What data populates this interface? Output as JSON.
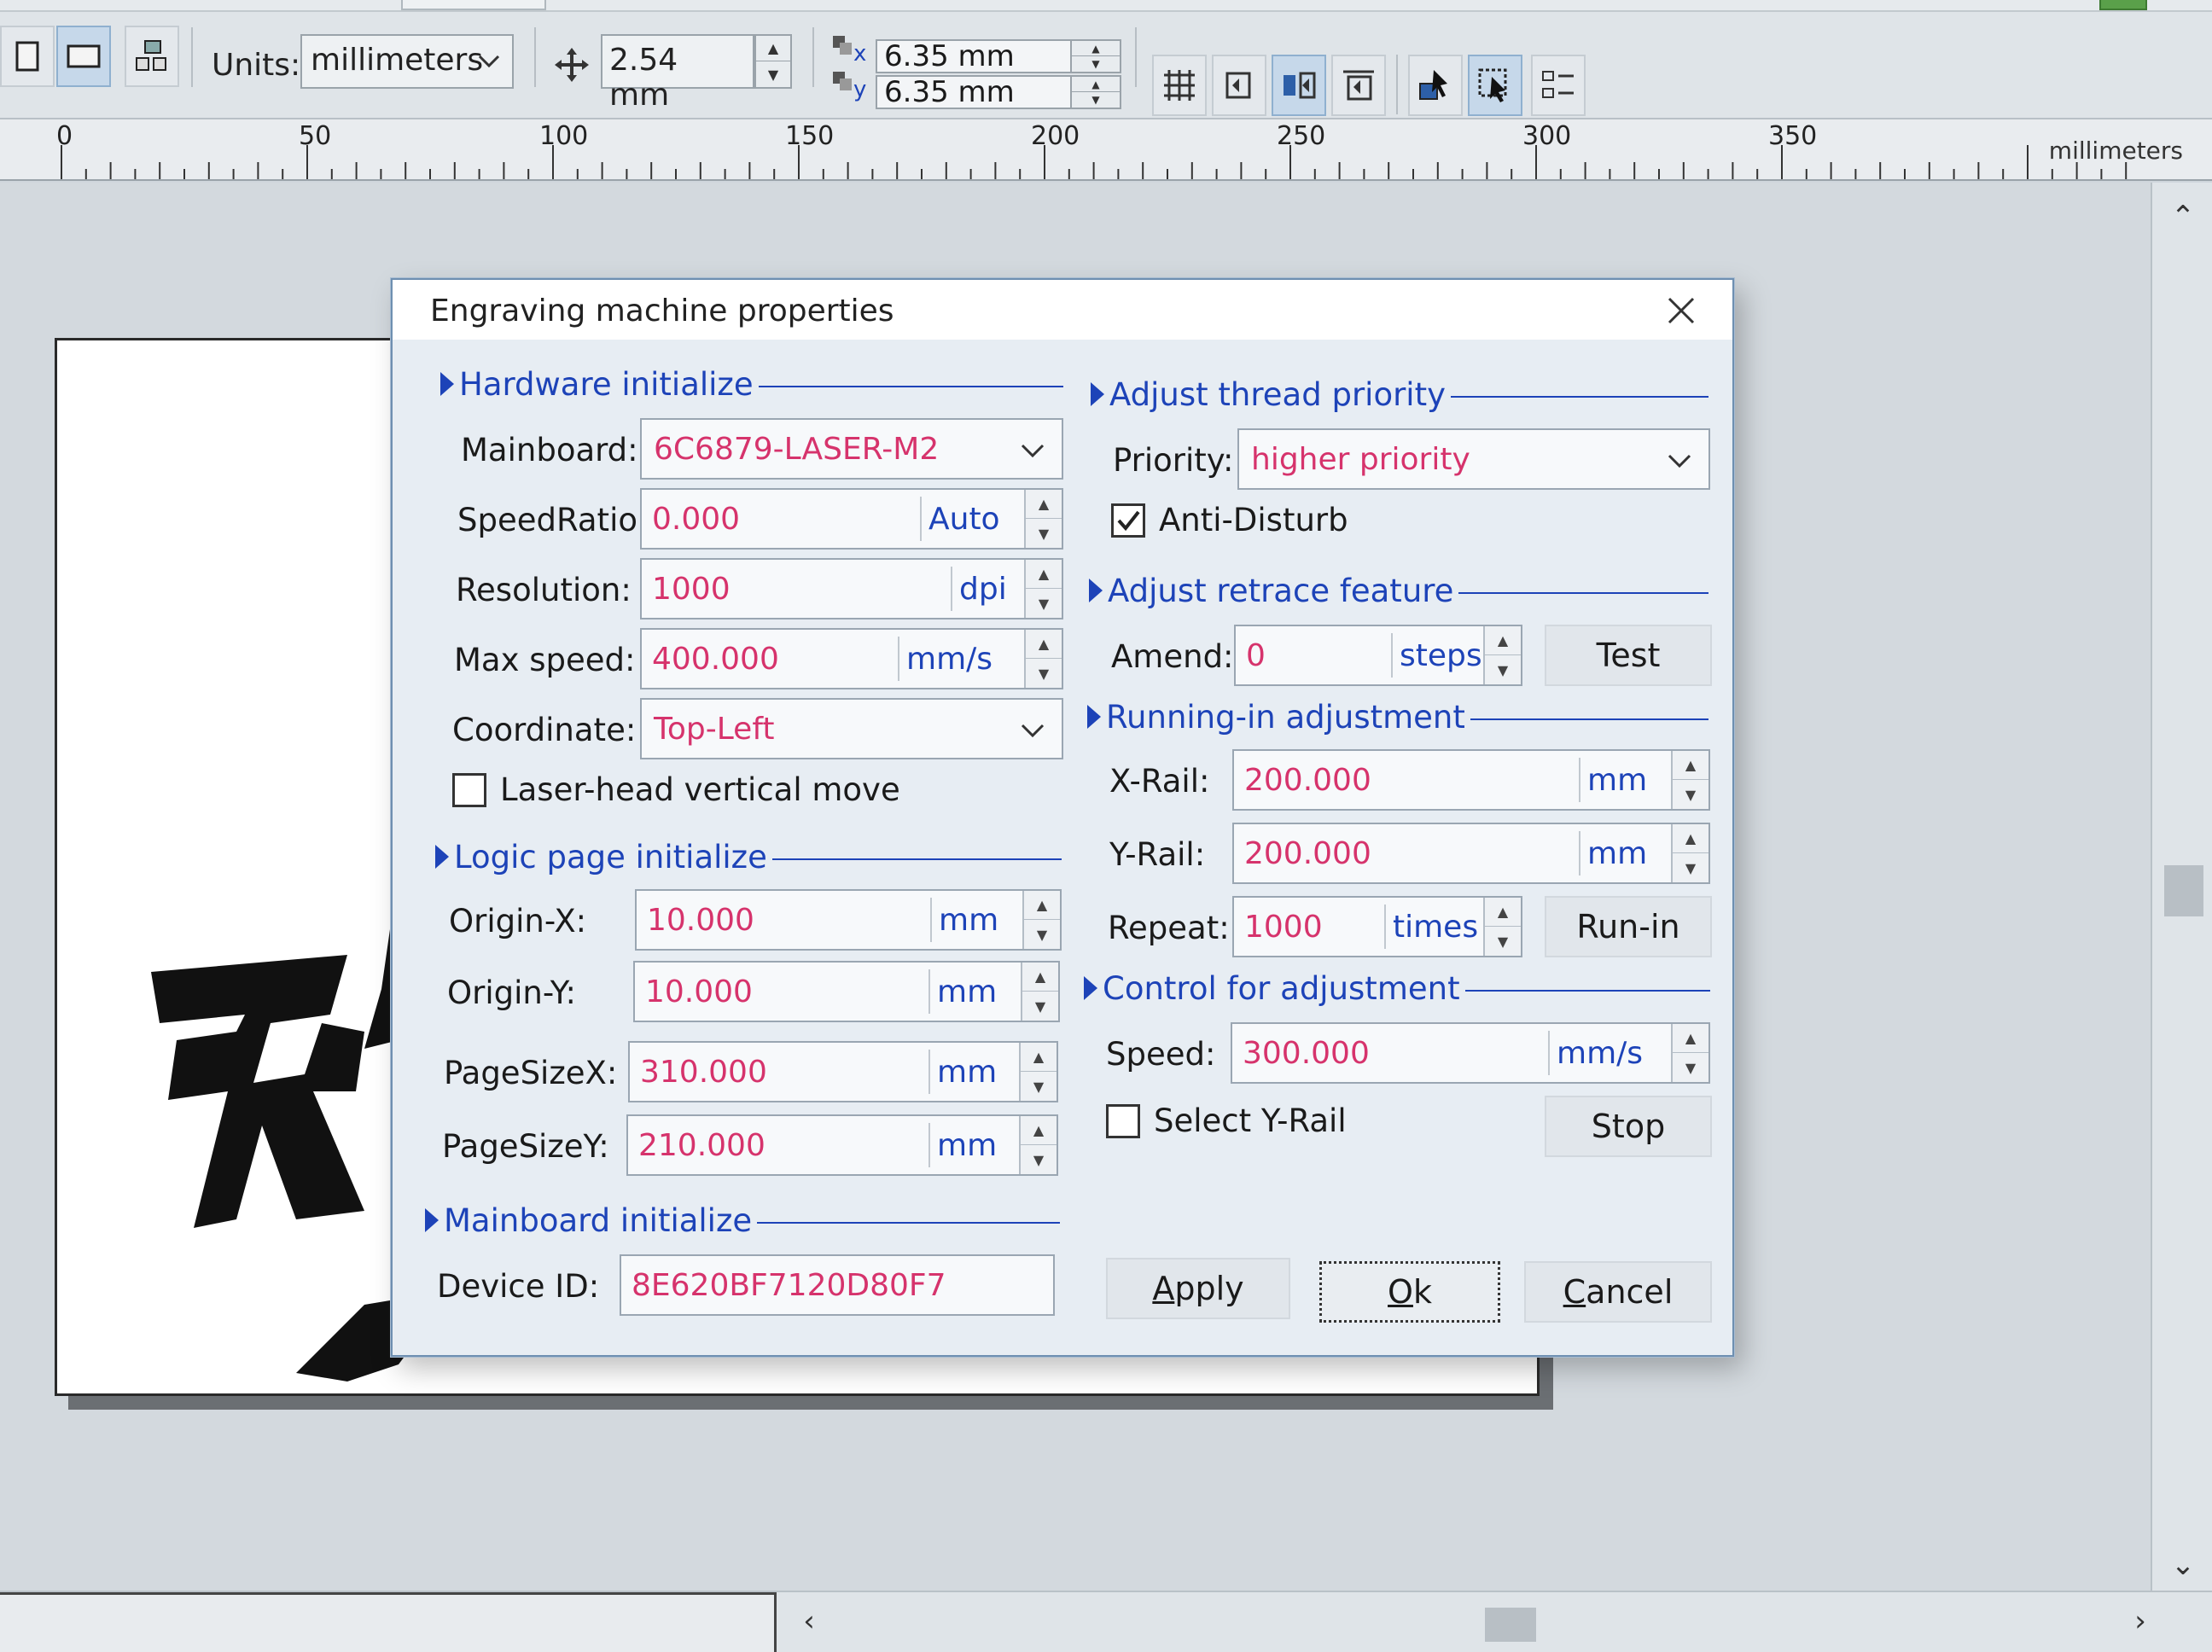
{
  "toolbar": {
    "units_label": "Units:",
    "units_value": "millimeters",
    "nudge_value": "2.54 mm",
    "dup_x": "6.35 mm",
    "dup_y": "6.35 mm",
    "dup_x_axis": "x",
    "dup_y_axis": "y"
  },
  "ruler": {
    "ticks": [
      "0",
      "50",
      "100",
      "150",
      "200",
      "250",
      "300",
      "350"
    ],
    "unit": "millimeters"
  },
  "dialog": {
    "title": "Engraving machine properties",
    "hardware": {
      "heading": "Hardware initialize",
      "mainboard_label": "Mainboard:",
      "mainboard_value": "6C6879-LASER-M2",
      "speedratio_label": "SpeedRatio:",
      "speedratio_value": "0.000",
      "speedratio_unit": "Auto",
      "resolution_label": "Resolution:",
      "resolution_value": "1000",
      "resolution_unit": "dpi",
      "maxspeed_label": "Max speed:",
      "maxspeed_value": "400.000",
      "maxspeed_unit": "mm/s",
      "coordinate_label": "Coordinate:",
      "coordinate_value": "Top-Left",
      "laserhead_label": "Laser-head vertical move"
    },
    "logic": {
      "heading": "Logic page initialize",
      "originx_label": "Origin-X:",
      "originx_value": "10.000",
      "originy_label": "Origin-Y:",
      "originy_value": "10.000",
      "pagesizex_label": "PageSizeX:",
      "pagesizex_value": "310.000",
      "pagesizey_label": "PageSizeY:",
      "pagesizey_value": "210.000",
      "unit": "mm"
    },
    "mainboard": {
      "heading": "Mainboard initialize",
      "deviceid_label": "Device ID:",
      "deviceid_value": "8E620BF7120D80F7"
    },
    "thread": {
      "heading": "Adjust thread priority",
      "priority_label": "Priority:",
      "priority_value": "higher priority",
      "antidisturb_label": "Anti-Disturb"
    },
    "retrace": {
      "heading": "Adjust retrace feature",
      "amend_label": "Amend:",
      "amend_value": "0",
      "amend_unit": "steps",
      "test_button": "Test"
    },
    "runin": {
      "heading": "Running-in adjustment",
      "xrail_label": "X-Rail:",
      "xrail_value": "200.000",
      "yrail_label": "Y-Rail:",
      "yrail_value": "200.000",
      "rail_unit": "mm",
      "repeat_label": "Repeat:",
      "repeat_value": "1000",
      "repeat_unit": "times",
      "runin_button": "Run-in"
    },
    "control": {
      "heading": "Control for adjustment",
      "speed_label": "Speed:",
      "speed_value": "300.000",
      "speed_unit": "mm/s",
      "selectyrail_label": "Select Y-Rail",
      "stop_button": "Stop"
    },
    "buttons": {
      "apply_first": "A",
      "apply_rest": "pply",
      "ok_first": "O",
      "ok_rest": "k",
      "cancel_first": "C",
      "cancel_rest": "ancel"
    }
  },
  "colors": {
    "value_text": "#d6336c",
    "section_heading": "#1d43b8",
    "unit_text": "#1d43b8"
  }
}
